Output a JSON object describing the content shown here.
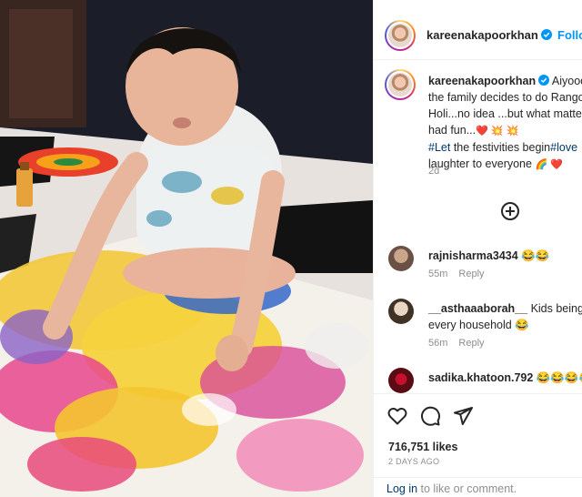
{
  "header": {
    "username": "kareenakapoorkhan",
    "follow_label": "Follo"
  },
  "caption": {
    "username": "kareenakapoorkhan",
    "line1_rest": " Aiyooo",
    "line2": "the family decides to do Rango",
    "line3": "Holi...no idea ...but what matte",
    "line4": "had fun...",
    "line4_emoji": "❤️ 💥 💥",
    "line5_tag1": "#Let",
    "line5_mid": " the festivities begin",
    "line5_tag2": "#love",
    "line6": "laughter to everyone",
    "line6_emoji": "🌈 ❤️",
    "age": "2d"
  },
  "comments": [
    {
      "username": "rajnisharma3434",
      "text": " 😂😂",
      "age": "55m",
      "reply": "Reply"
    },
    {
      "username": "__asthaaaborah__",
      "text": " Kids being k",
      "line2": "every household 😂",
      "age": "56m",
      "reply": "Reply"
    },
    {
      "username": "sadika.khatoon.792",
      "text": " 😂😂😂😂"
    }
  ],
  "actions": {
    "like_icon": "heart-icon",
    "comment_icon": "comment-icon",
    "share_icon": "share-icon"
  },
  "likes": "716,751 likes",
  "posted": "2 DAYS AGO",
  "login_bar": {
    "login": "Log in",
    "rest": " to like or comment."
  },
  "colors": {
    "link": "#0095f6",
    "text": "#262626",
    "muted": "#8e8e8e",
    "like_red": "#ed4956"
  }
}
